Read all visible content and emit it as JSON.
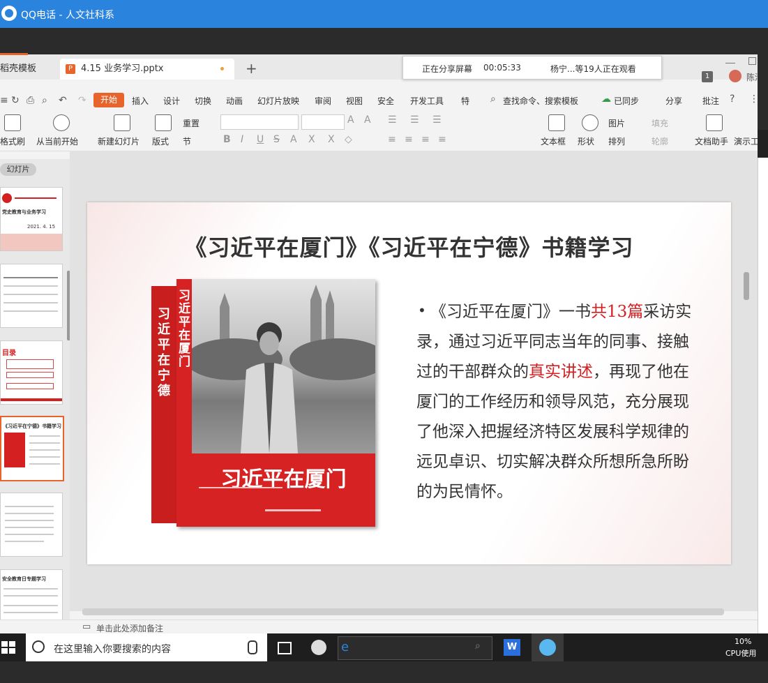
{
  "window": {
    "title": "QQ电话 - 人文社科系"
  },
  "tabs": [
    {
      "label": "稻壳模板"
    },
    {
      "label": "4.15 业务学习.pptx"
    }
  ],
  "share": {
    "status": "正在分享屏幕",
    "time": "00:05:33",
    "viewers": "杨宁...等19人正在观看"
  },
  "user": {
    "name": "陈清友",
    "count": "1"
  },
  "menu": {
    "start": "开始",
    "items": [
      "插入",
      "设计",
      "切换",
      "动画",
      "幻灯片放映",
      "审阅",
      "视图",
      "安全",
      "开发工具",
      "特"
    ],
    "search": "查找命令、搜索模板",
    "sync": "已同步",
    "share": "分享",
    "comment": "批注"
  },
  "ribbon": {
    "format_painter": "格式刷",
    "play_from_current": "从当前开始",
    "new_slide": "新建幻灯片",
    "layout": "版式",
    "reset": "重置",
    "section": "节",
    "textbox": "文本框",
    "shape": "形状",
    "picture": "图片",
    "arrange": "排列",
    "fill": "填充",
    "outline": "轮廓",
    "doc_helper": "文档助手",
    "presenter": "演示工"
  },
  "left_panel": {
    "label": "幻灯片",
    "thumb1_title": "党史教育与业务学习",
    "thumb1_date": "2021. 4. 15",
    "thumb3_title": "目录",
    "thumb4_title": "《习近平在宁德》书籍学习",
    "thumb6_title": "安全教育日专题学习"
  },
  "slide": {
    "title": "《习近平在厦门》《习近平在宁德》书籍学习",
    "book_spine": "习近平在宁德",
    "book_side": "习近平在厦门",
    "book_front": "习近平在厦门",
    "body_1": "《习近平在厦门》一书",
    "body_red_1": "共13篇",
    "body_2": "采访实录，通过习近平同志当年的同事、接触过的干部群众的",
    "body_red_2": "真实讲述",
    "body_3": "，再现了他在厦门的工作经历和领导风范，充分展现了他深入把握经济特区发展科学规律的远见卓识、切实解决群众所想所急所盼的为民情怀。"
  },
  "status_bar": {
    "notes": "单击此处添加备注"
  },
  "taskbar": {
    "search": "在这里输入你要搜索的内容",
    "cpu": "10%",
    "cpu_label": "CPU使用"
  },
  "colors": {
    "accent": "#e8642d",
    "qq_blue": "#2a83dc",
    "highlight_red": "#d42020"
  }
}
